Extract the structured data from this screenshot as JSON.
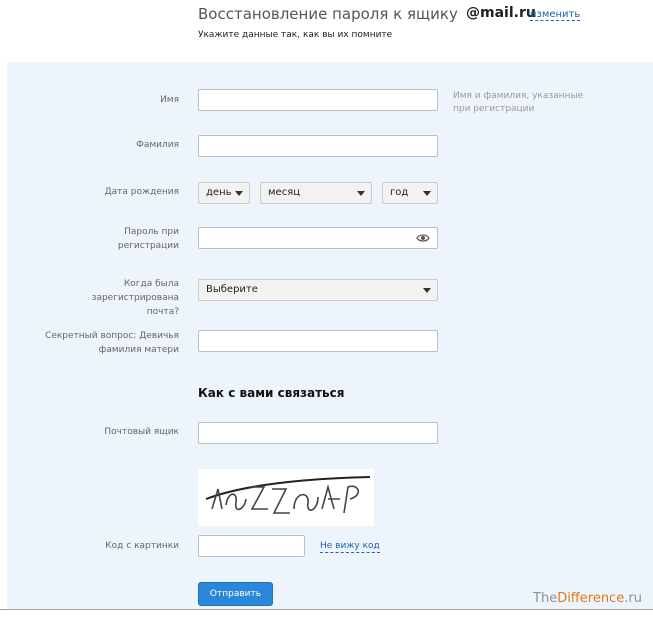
{
  "header": {
    "title": "Восстановление пароля к ящику",
    "domain": "@mail.ru",
    "change_link": "изменить",
    "subtitle": "Укажите данные так, как вы их помните"
  },
  "form": {
    "first_name": {
      "label": "Имя",
      "value": ""
    },
    "name_hint": "Имя и фамилия, указанные при регистрации",
    "last_name": {
      "label": "Фамилия",
      "value": ""
    },
    "birth_date": {
      "label": "Дата рождения",
      "day": "день",
      "month": "месяц",
      "year": "год"
    },
    "password": {
      "label": "Пароль при регистрации",
      "value": ""
    },
    "registration_time": {
      "label": "Когда была зарегистрирована почта?",
      "selected": "Выберите"
    },
    "secret_question": {
      "label": "Секретный вопрос: Девичья фамилия матери",
      "value": ""
    },
    "contact_section_title": "Как с вами связаться",
    "contact_email": {
      "label": "Почтовый ящик",
      "value": ""
    },
    "captcha": {
      "label": "Код с картинки",
      "value": "",
      "not_see_link": "Не вижу код"
    },
    "submit_label": "Отправить"
  },
  "watermark": {
    "the": "The",
    "difference": "Difference",
    "ru": ".ru"
  },
  "colors": {
    "accent": "#2b87d9",
    "form_bg": "#eef4fb",
    "link": "#1a63b8"
  },
  "icons": {
    "password_toggle": "eye-icon",
    "dropdown": "caret-down-icon"
  }
}
